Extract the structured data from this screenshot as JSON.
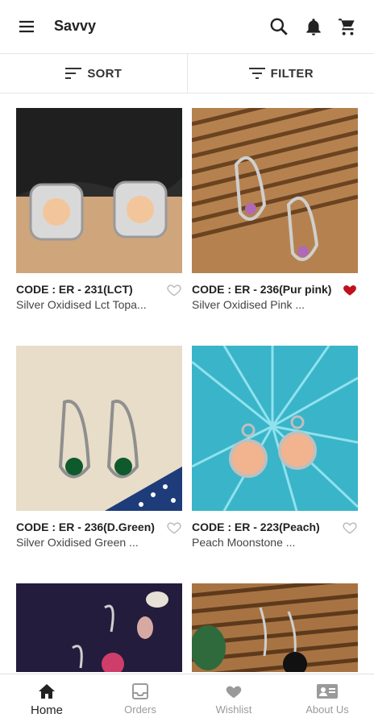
{
  "app": {
    "title": "Savvy"
  },
  "toolbar": {
    "sort_label": "SORT",
    "filter_label": "FILTER"
  },
  "products": [
    {
      "code": "CODE : ER - 231(LCT)",
      "name": "Silver Oxidised Lct Topa...",
      "wishlisted": false
    },
    {
      "code": "CODE : ER - 236(Pur pink)",
      "name": "Silver Oxidised Pink ...",
      "wishlisted": true
    },
    {
      "code": "CODE : ER - 236(D.Green)",
      "name": "Silver Oxidised Green ...",
      "wishlisted": false
    },
    {
      "code": "CODE : ER - 223(Peach)",
      "name": "Peach Moonstone ...",
      "wishlisted": false
    }
  ],
  "nav": {
    "home": "Home",
    "orders": "Orders",
    "wishlist": "Wishlist",
    "about": "About Us"
  },
  "colors": {
    "heart_active": "#c0121c",
    "heart_inactive": "#bdbdbd",
    "text": "#222222"
  }
}
